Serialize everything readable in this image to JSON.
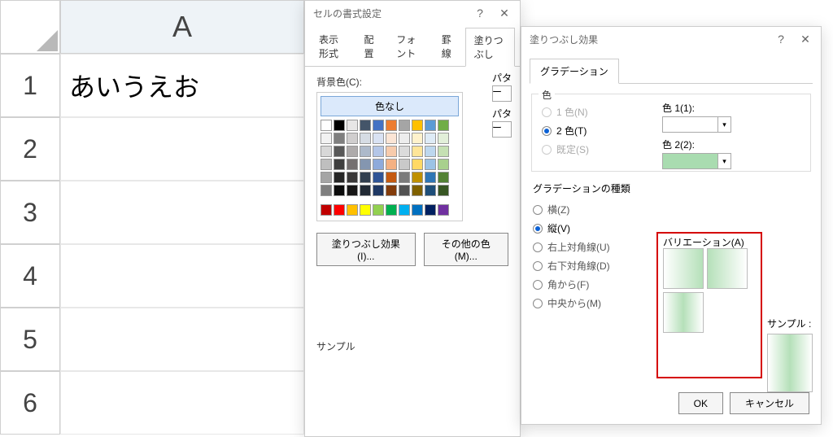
{
  "sheet": {
    "col_label": "A",
    "rows": [
      "1",
      "2",
      "3",
      "4",
      "5",
      "6"
    ],
    "a1": "あいうえお"
  },
  "dlg_format": {
    "title": "セルの書式設定",
    "tabs": [
      "表示形式",
      "配置",
      "フォント",
      "罫線",
      "塗りつぶし"
    ],
    "bgcolor_label": "背景色(C):",
    "nocolor": "色なし",
    "pattern_color_label": "パター",
    "pattern_style_label": "パター",
    "fill_effects_btn": "塗りつぶし効果(I)...",
    "more_colors_btn": "その他の色(M)...",
    "sample_label": "サンプル",
    "palette": {
      "row1": [
        "#ffffff",
        "#000000",
        "#e7e6e6",
        "#445569",
        "#4472c4",
        "#ed7d31",
        "#a5a5a5",
        "#ffc000",
        "#5b9bd5",
        "#70ad47"
      ],
      "row2": [
        "#f2f2f2",
        "#7f7f7f",
        "#d0cece",
        "#d6dce4",
        "#d9e2f3",
        "#fbe5d5",
        "#ededed",
        "#fff2cc",
        "#deebf6",
        "#e2efd9"
      ],
      "row3": [
        "#d8d8d8",
        "#595959",
        "#aeabab",
        "#adb9ca",
        "#b4c6e7",
        "#f7cbac",
        "#dbdbdb",
        "#fee599",
        "#bdd7ee",
        "#c5e0b3"
      ],
      "row4": [
        "#bfbfbf",
        "#3f3f3f",
        "#757070",
        "#8496b0",
        "#8eaadb",
        "#f4b183",
        "#c9c9c9",
        "#ffd965",
        "#9cc3e5",
        "#a8d08d"
      ],
      "row5": [
        "#a5a5a5",
        "#262626",
        "#3a3838",
        "#323f4f",
        "#2f5496",
        "#c55a11",
        "#7b7b7b",
        "#bf9000",
        "#2e75b5",
        "#538135"
      ],
      "row6": [
        "#7f7f7f",
        "#0c0c0c",
        "#171616",
        "#222a35",
        "#1f3864",
        "#833c0b",
        "#525252",
        "#7f6000",
        "#1e4e79",
        "#375623"
      ],
      "std": [
        "#c00000",
        "#ff0000",
        "#ffc000",
        "#ffff00",
        "#92d050",
        "#00b050",
        "#00b0f0",
        "#0070c0",
        "#002060",
        "#7030a0"
      ]
    }
  },
  "dlg_fill": {
    "title": "塗りつぶし効果",
    "tab": "グラデーション",
    "group_color": "色",
    "opt_1color": "1 色(N)",
    "opt_2color": "2 色(T)",
    "opt_preset": "既定(S)",
    "color1_label": "色 1(1):",
    "color2_label": "色 2(2):",
    "color1_value": "#ffffff",
    "color2_value": "#a9dcb0",
    "group_type": "グラデーションの種類",
    "type_opts": [
      {
        "label": "横(Z)",
        "sel": false
      },
      {
        "label": "縦(V)",
        "sel": true
      },
      {
        "label": "右上対角線(U)",
        "sel": false
      },
      {
        "label": "右下対角線(D)",
        "sel": false
      },
      {
        "label": "角から(F)",
        "sel": false
      },
      {
        "label": "中央から(M)",
        "sel": false
      }
    ],
    "variations_label": "バリエーション(A)",
    "sample_label": "サンプル :",
    "ok": "OK",
    "cancel": "キャンセル"
  }
}
